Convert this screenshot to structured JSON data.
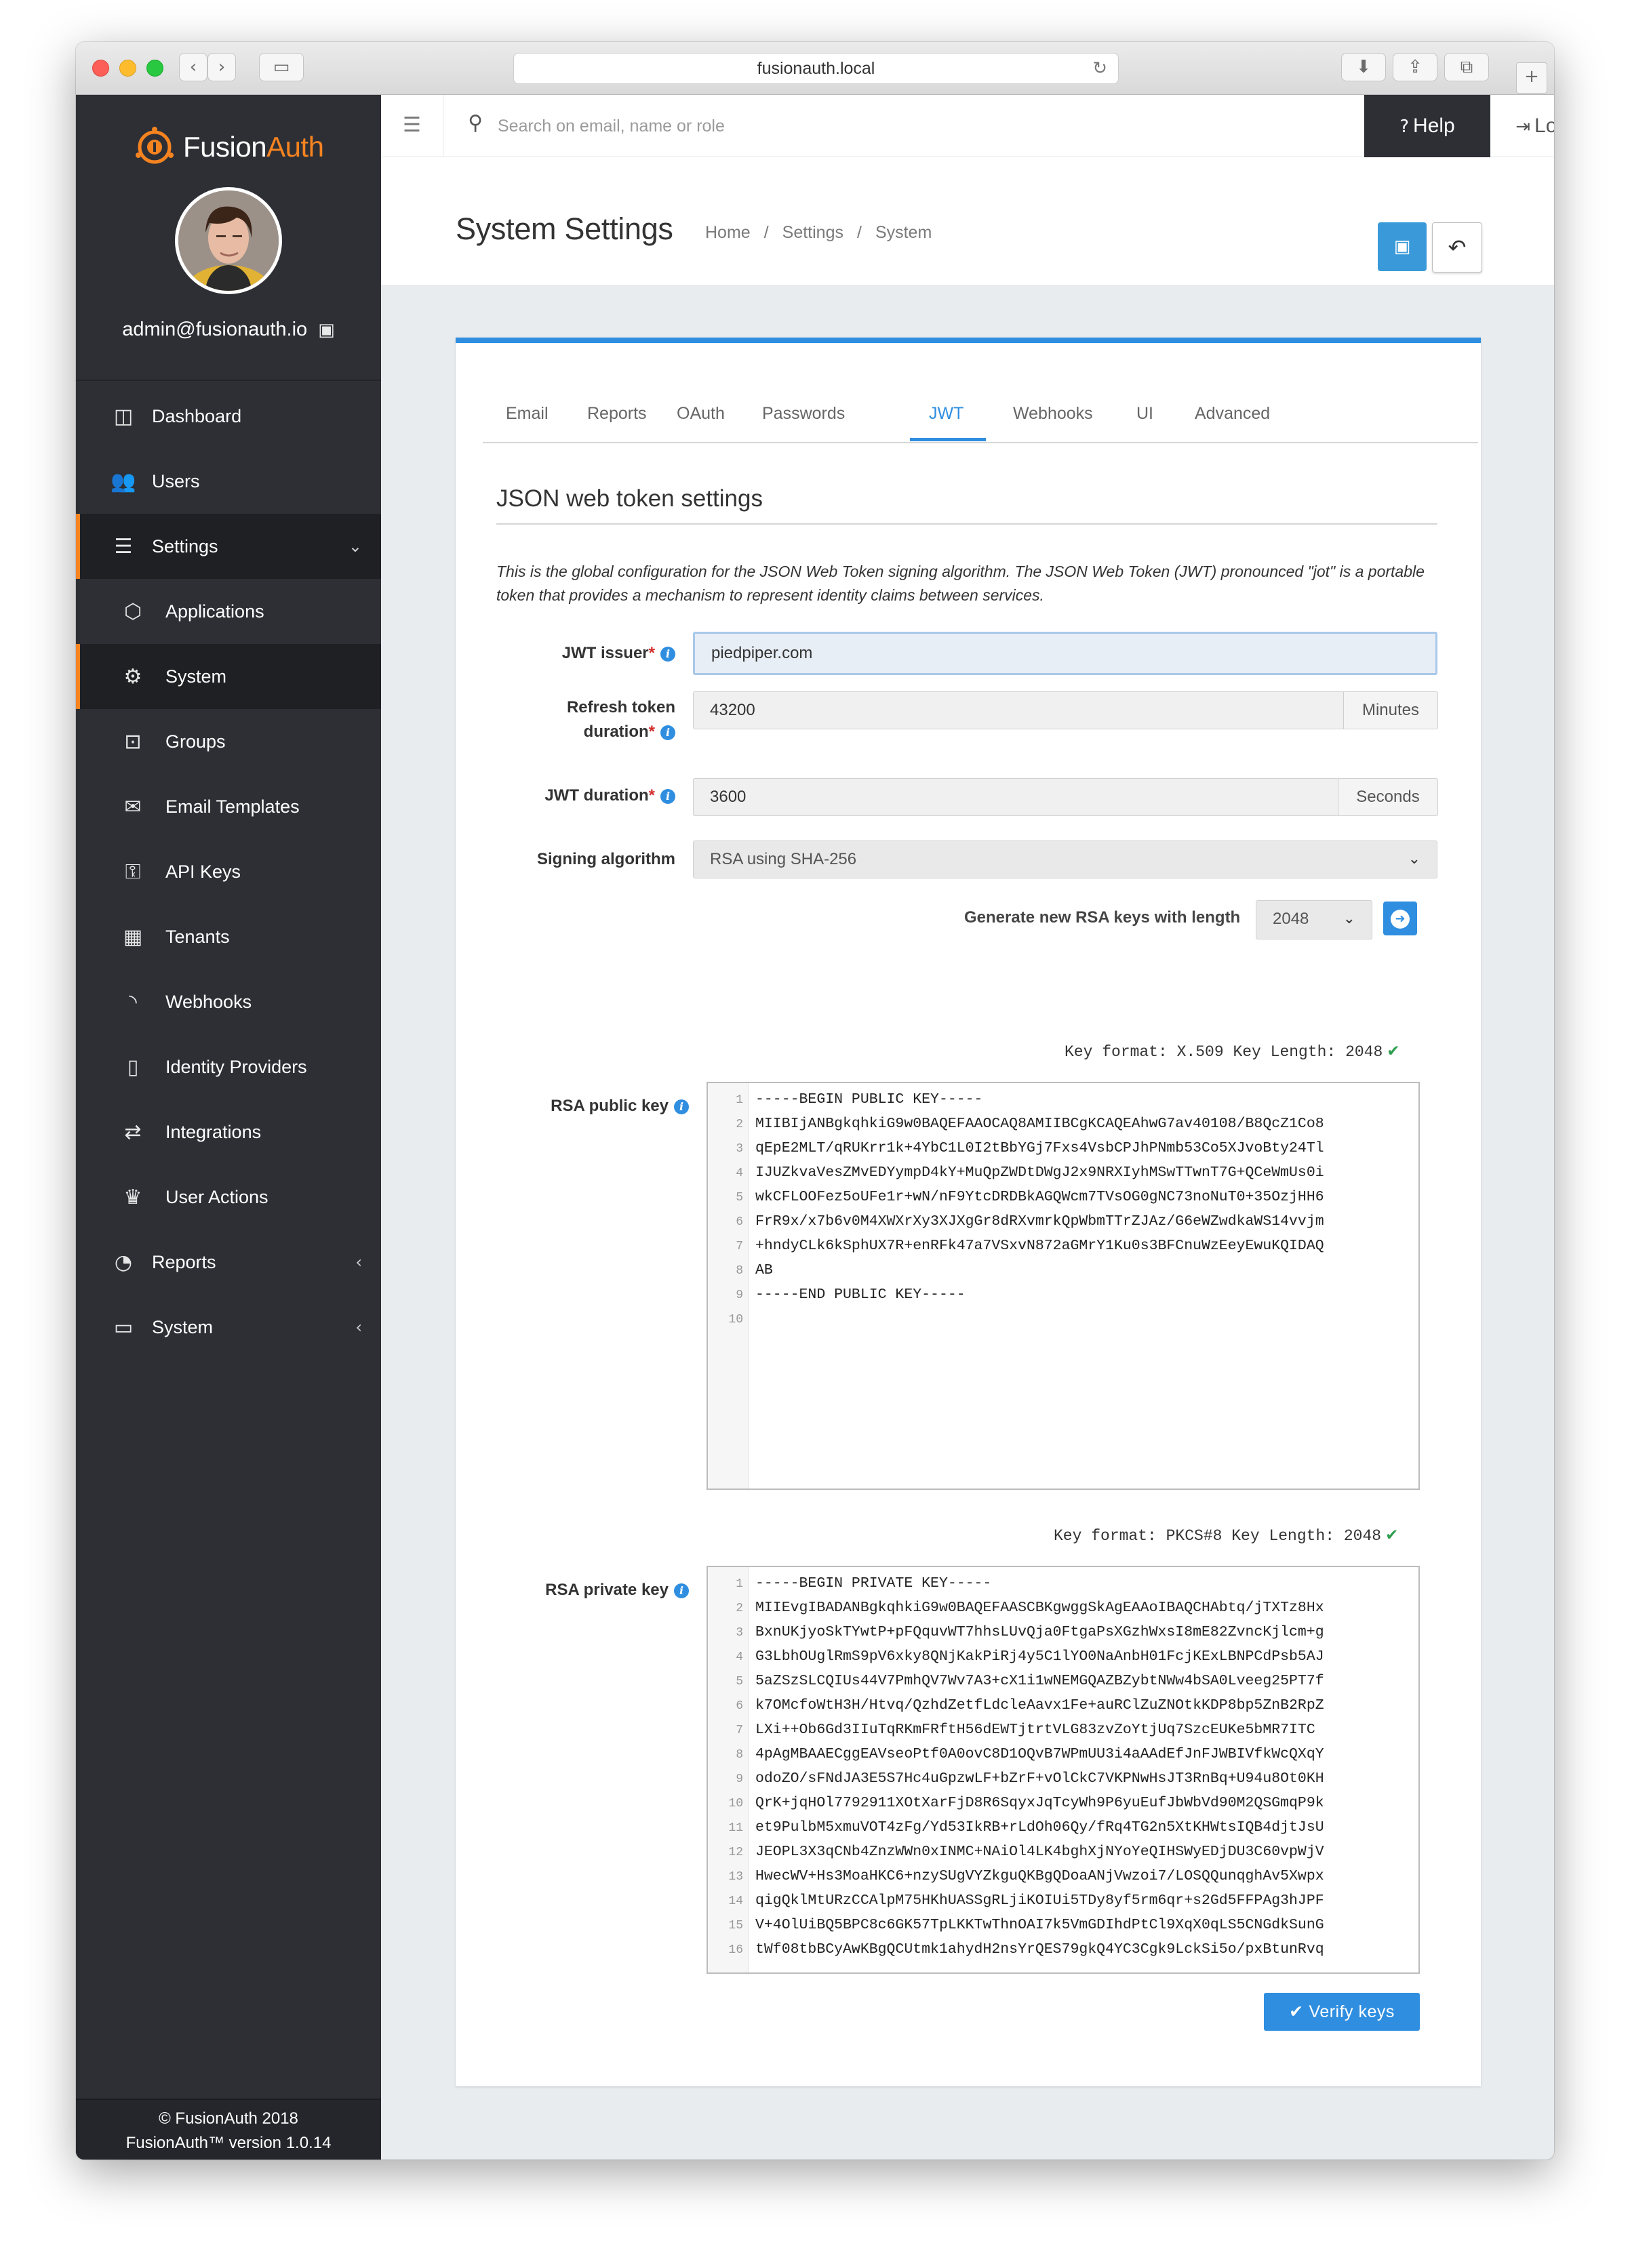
{
  "browser": {
    "url": "fusionauth.local"
  },
  "sidebar": {
    "brand": {
      "prefix": "Fusion",
      "suffix": "Auth"
    },
    "user_email": "admin@fusionauth.io",
    "items": [
      {
        "label": "Dashboard",
        "icon": "dashboard-icon"
      },
      {
        "label": "Users",
        "icon": "users-icon"
      },
      {
        "label": "Settings",
        "icon": "sliders-icon",
        "expanded": true
      },
      {
        "label": "Applications",
        "icon": "cube-icon"
      },
      {
        "label": "System",
        "icon": "gear-icon",
        "active": true
      },
      {
        "label": "Groups",
        "icon": "groups-icon"
      },
      {
        "label": "Email Templates",
        "icon": "envelope-icon"
      },
      {
        "label": "API Keys",
        "icon": "key-icon"
      },
      {
        "label": "Tenants",
        "icon": "building-icon"
      },
      {
        "label": "Webhooks",
        "icon": "rss-icon"
      },
      {
        "label": "Identity Providers",
        "icon": "id-badge-icon"
      },
      {
        "label": "Integrations",
        "icon": "exchange-icon"
      },
      {
        "label": "User Actions",
        "icon": "trophy-icon"
      },
      {
        "label": "Reports",
        "icon": "pie-chart-icon"
      },
      {
        "label": "System",
        "icon": "desktop-icon"
      }
    ],
    "footer": {
      "copyright": "© FusionAuth 2018",
      "version": "FusionAuth™ version 1.0.14"
    }
  },
  "topbar": {
    "search_placeholder": "Search on email, name or role",
    "help_label": "Help",
    "logout_label": "Logout"
  },
  "header": {
    "title": "System Settings",
    "breadcrumb": [
      "Home",
      "Settings",
      "System"
    ]
  },
  "tabs": [
    "Email",
    "Reports",
    "OAuth",
    "Passwords",
    "JWT",
    "Webhooks",
    "UI",
    "Advanced"
  ],
  "jwt": {
    "section_title": "JSON web token settings",
    "description": "This is the global configuration for the JSON Web Token signing algorithm. The JSON Web Token (JWT) pronounced \"jot\" is a portable token that provides a mechanism to represent identity claims between services.",
    "issuer": {
      "label": "JWT issuer",
      "value": "piedpiper.com"
    },
    "refresh": {
      "label_line1": "Refresh token",
      "label_line2": "duration",
      "value": "43200",
      "unit": "Minutes"
    },
    "duration": {
      "label": "JWT duration",
      "value": "3600",
      "unit": "Seconds"
    },
    "signing": {
      "label": "Signing algorithm",
      "value": "RSA using SHA-256"
    },
    "generate": {
      "label": "Generate new RSA keys with length",
      "value": "2048"
    },
    "public_key": {
      "label": "RSA public key",
      "meta": "Key format: X.509 Key Length: 2048",
      "lines": [
        "-----BEGIN PUBLIC KEY-----",
        "MIIBIjANBgkqhkiG9w0BAQEFAAOCAQ8AMIIBCgKCAQEAhwG7av40108/B8QcZ1Co8",
        "qEpE2MLT/qRUKrr1k+4YbC1L0I2tBbYGj7Fxs4VsbCPJhPNmb53Co5XJvoBty24Tl",
        "IJUZkvaVesZMvEDYympD4kY+MuQpZWDtDWgJ2x9NRXIyhMSwTTwnT7G+QCeWmUs0i",
        "wkCFLOOFez5oUFe1r+wN/nF9YtcDRDBkAGQWcm7TVsOG0gNC73noNuT0+35OzjHH6",
        "FrR9x/x7b6v0M4XWXrXy3XJXgGr8dRXvmrkQpWbmTTrZJAz/G6eWZwdkaWS14vvjm",
        "+hndyCLk6kSphUX7R+enRFk47a7VSxvN872aGMrY1Ku0s3BFCnuWzEeyEwuKQIDAQ",
        "AB",
        "-----END PUBLIC KEY-----",
        ""
      ]
    },
    "private_key": {
      "label": "RSA private key",
      "meta": "Key format: PKCS#8 Key Length: 2048",
      "lines": [
        "-----BEGIN PRIVATE KEY-----",
        "MIIEvgIBADANBgkqhkiG9w0BAQEFAASCBKgwggSkAgEAAoIBAQCHAbtq/jTXTz8Hx",
        "BxnUKjyoSkTYwtP+pFQquvWT7hhsLUvQja0FtgaPsXGzhWxsI8mE82ZvncKjlcm+g",
        "G3LbhOUglRmS9pV6xky8QNjKakPiRj4y5C1lYO0NaAnbH01FcjKExLBNPCdPsb5AJ",
        "5aZSzSLCQIUs44V7PmhQV7Wv7A3+cX1i1wNEMGQAZBZybtNWw4bSA0Lveeg25PT7f",
        "k7OMcfoWtH3H/Htvq/QzhdZetfLdcleAavx1Fe+auRClZuZNOtkKDP8bp5ZnB2RpZ",
        "LXi++Ob6Gd3IIuTqRKmFRftH56dEWTjtrtVLG83zvZoYtjUq7SzcEUKe5bMR7ITC",
        "4pAgMBAAECggEAVseoPtf0A0ovC8D1OQvB7WPmUU3i4aAAdEfJnFJWBIVfkWcQXqY",
        "odoZO/sFNdJA3E5S7Hc4uGpzwLF+bZrF+vOlCkC7VKPNwHsJT3RnBq+U94u8Ot0KH",
        "QrK+jqHOl7792911XOtXarFjD8R6SqyxJqTcyWh9P6yuEufJbWbVd90M2QSGmqP9k",
        "et9PulbM5xmuVOT4zFg/Yd53IkRB+rLdOh06Qy/fRq4TG2n5XtKHWtsIQB4djtJsU",
        "JEOPL3X3qCNb4ZnzWWn0xINMC+NAiOl4LK4bghXjNYoYeQIHSWyEDjDU3C60vpWjV",
        "HwecWV+Hs3MoaHKC6+nzySUgVYZkguQKBgQDoaANjVwzoi7/LOSQQunqghAv5Xwpx",
        "qigQklMtURzCCAlpM75HKhUASSgRLjiKOIUi5TDy8yf5rm6qr+s2Gd5FFPAg3hJPF",
        "V+4OlUiBQ5BPC8c6GK57TpLKKTwThnOAI7k5VmGDIhdPtCl9XqX0qLS5CNGdkSunG",
        "tWf08tbBCyAwKBgQCUtmk1ahydH2nsYrQES79gkQ4YC3Cgk9LckSi5o/pxBtunRvq"
      ]
    },
    "verify_label": "Verify keys"
  }
}
